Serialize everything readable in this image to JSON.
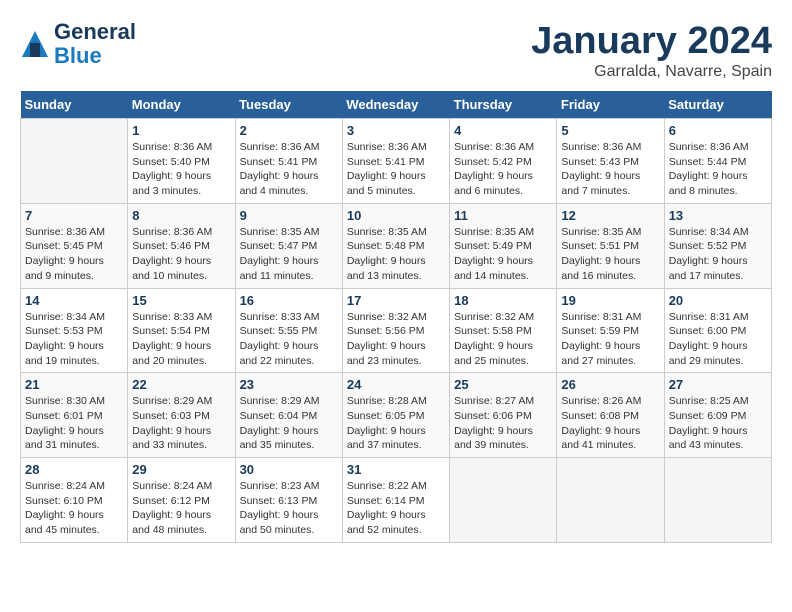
{
  "header": {
    "logo_line1": "General",
    "logo_line2": "Blue",
    "month": "January 2024",
    "location": "Garralda, Navarre, Spain"
  },
  "weekdays": [
    "Sunday",
    "Monday",
    "Tuesday",
    "Wednesday",
    "Thursday",
    "Friday",
    "Saturday"
  ],
  "weeks": [
    [
      {
        "day": "",
        "info": ""
      },
      {
        "day": "1",
        "info": "Sunrise: 8:36 AM\nSunset: 5:40 PM\nDaylight: 9 hours\nand 3 minutes."
      },
      {
        "day": "2",
        "info": "Sunrise: 8:36 AM\nSunset: 5:41 PM\nDaylight: 9 hours\nand 4 minutes."
      },
      {
        "day": "3",
        "info": "Sunrise: 8:36 AM\nSunset: 5:41 PM\nDaylight: 9 hours\nand 5 minutes."
      },
      {
        "day": "4",
        "info": "Sunrise: 8:36 AM\nSunset: 5:42 PM\nDaylight: 9 hours\nand 6 minutes."
      },
      {
        "day": "5",
        "info": "Sunrise: 8:36 AM\nSunset: 5:43 PM\nDaylight: 9 hours\nand 7 minutes."
      },
      {
        "day": "6",
        "info": "Sunrise: 8:36 AM\nSunset: 5:44 PM\nDaylight: 9 hours\nand 8 minutes."
      }
    ],
    [
      {
        "day": "7",
        "info": "Sunrise: 8:36 AM\nSunset: 5:45 PM\nDaylight: 9 hours\nand 9 minutes."
      },
      {
        "day": "8",
        "info": "Sunrise: 8:36 AM\nSunset: 5:46 PM\nDaylight: 9 hours\nand 10 minutes."
      },
      {
        "day": "9",
        "info": "Sunrise: 8:35 AM\nSunset: 5:47 PM\nDaylight: 9 hours\nand 11 minutes."
      },
      {
        "day": "10",
        "info": "Sunrise: 8:35 AM\nSunset: 5:48 PM\nDaylight: 9 hours\nand 13 minutes."
      },
      {
        "day": "11",
        "info": "Sunrise: 8:35 AM\nSunset: 5:49 PM\nDaylight: 9 hours\nand 14 minutes."
      },
      {
        "day": "12",
        "info": "Sunrise: 8:35 AM\nSunset: 5:51 PM\nDaylight: 9 hours\nand 16 minutes."
      },
      {
        "day": "13",
        "info": "Sunrise: 8:34 AM\nSunset: 5:52 PM\nDaylight: 9 hours\nand 17 minutes."
      }
    ],
    [
      {
        "day": "14",
        "info": "Sunrise: 8:34 AM\nSunset: 5:53 PM\nDaylight: 9 hours\nand 19 minutes."
      },
      {
        "day": "15",
        "info": "Sunrise: 8:33 AM\nSunset: 5:54 PM\nDaylight: 9 hours\nand 20 minutes."
      },
      {
        "day": "16",
        "info": "Sunrise: 8:33 AM\nSunset: 5:55 PM\nDaylight: 9 hours\nand 22 minutes."
      },
      {
        "day": "17",
        "info": "Sunrise: 8:32 AM\nSunset: 5:56 PM\nDaylight: 9 hours\nand 23 minutes."
      },
      {
        "day": "18",
        "info": "Sunrise: 8:32 AM\nSunset: 5:58 PM\nDaylight: 9 hours\nand 25 minutes."
      },
      {
        "day": "19",
        "info": "Sunrise: 8:31 AM\nSunset: 5:59 PM\nDaylight: 9 hours\nand 27 minutes."
      },
      {
        "day": "20",
        "info": "Sunrise: 8:31 AM\nSunset: 6:00 PM\nDaylight: 9 hours\nand 29 minutes."
      }
    ],
    [
      {
        "day": "21",
        "info": "Sunrise: 8:30 AM\nSunset: 6:01 PM\nDaylight: 9 hours\nand 31 minutes."
      },
      {
        "day": "22",
        "info": "Sunrise: 8:29 AM\nSunset: 6:03 PM\nDaylight: 9 hours\nand 33 minutes."
      },
      {
        "day": "23",
        "info": "Sunrise: 8:29 AM\nSunset: 6:04 PM\nDaylight: 9 hours\nand 35 minutes."
      },
      {
        "day": "24",
        "info": "Sunrise: 8:28 AM\nSunset: 6:05 PM\nDaylight: 9 hours\nand 37 minutes."
      },
      {
        "day": "25",
        "info": "Sunrise: 8:27 AM\nSunset: 6:06 PM\nDaylight: 9 hours\nand 39 minutes."
      },
      {
        "day": "26",
        "info": "Sunrise: 8:26 AM\nSunset: 6:08 PM\nDaylight: 9 hours\nand 41 minutes."
      },
      {
        "day": "27",
        "info": "Sunrise: 8:25 AM\nSunset: 6:09 PM\nDaylight: 9 hours\nand 43 minutes."
      }
    ],
    [
      {
        "day": "28",
        "info": "Sunrise: 8:24 AM\nSunset: 6:10 PM\nDaylight: 9 hours\nand 45 minutes."
      },
      {
        "day": "29",
        "info": "Sunrise: 8:24 AM\nSunset: 6:12 PM\nDaylight: 9 hours\nand 48 minutes."
      },
      {
        "day": "30",
        "info": "Sunrise: 8:23 AM\nSunset: 6:13 PM\nDaylight: 9 hours\nand 50 minutes."
      },
      {
        "day": "31",
        "info": "Sunrise: 8:22 AM\nSunset: 6:14 PM\nDaylight: 9 hours\nand 52 minutes."
      },
      {
        "day": "",
        "info": ""
      },
      {
        "day": "",
        "info": ""
      },
      {
        "day": "",
        "info": ""
      }
    ]
  ]
}
